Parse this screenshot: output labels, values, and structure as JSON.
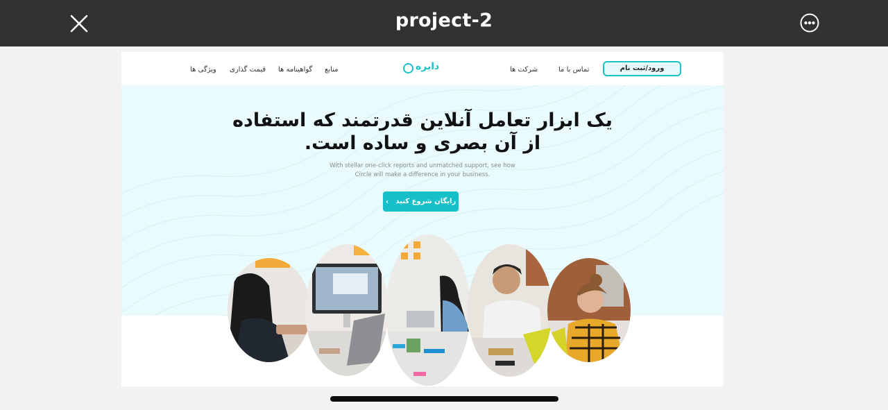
{
  "window": {
    "title": "project-2"
  },
  "icons": {
    "close": "close-icon",
    "more": "more-options-icon",
    "cta": "chevron-icon"
  },
  "nav": {
    "login_label": "ورود/ثبت نام",
    "contact_label": "تماس با ما",
    "companies_label": "شرکت ها",
    "brand_name": "دایره",
    "resources_label": "منابع",
    "certificates_label": "گواهینامه ها",
    "pricing_label": "قیمت گذاری",
    "features_label": "ویژگی ها"
  },
  "hero": {
    "title_line1": "یک ابزار تعامل آنلاین قدرتمند که استفاده",
    "title_line2": "از آن بصری و ساده است.",
    "subtitle_line1": "With stellar one-click reports and unmatched support, see how",
    "subtitle_line2": "Circle will make a difference in your business.",
    "cta_label": "رایگان شروع کنید",
    "cta_chevron": "›"
  },
  "colors": {
    "accent": "#19c1c9",
    "topbar": "#323232",
    "hero_bg": "#e9fbfc"
  }
}
